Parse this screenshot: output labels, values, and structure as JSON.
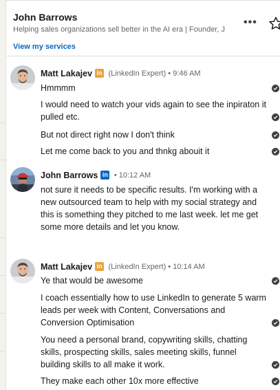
{
  "header": {
    "name": "John Barrows",
    "headline": "Helping sales organizations sell better in the AI era | Founder, J",
    "view_services": "View my services",
    "more_icon": "•••",
    "star_icon": "star-icon"
  },
  "groups": [
    {
      "sender": "Matt Lakajev",
      "badge": "in",
      "badge_color": "#e7a33e",
      "meta": "(LinkedIn Expert) • 9:46 AM",
      "messages": [
        "Hmmmm",
        "I would need to watch your vids again to see the inpiraton it pulled etc.",
        "But not direct right now I don't think",
        "Let me come back to you and thnkg abouit it"
      ]
    },
    {
      "sender": "John Barrows",
      "badge": "in",
      "badge_color": "#0a66c2",
      "meta": "• 10:12 AM",
      "messages": [
        "not sure it needs to be specific results.  I'm working with a new outsourced team to help with my social strategy and this is something they pitched to me last week.  let me get some more details and let you know."
      ]
    },
    {
      "sender": "Matt Lakajev",
      "badge": "in",
      "badge_color": "#e7a33e",
      "meta": "(LinkedIn Expert) • 10:14 AM",
      "messages": [
        "Ye that would be awesome",
        "I coach essentially how to use LinkedIn to generate 5 warm leads per week with Content, Conversations and Conversion Optimisation",
        "You need a personal brand, copywriting skills, chatting skills, prospecting skills, sales meeting skills, funnel building skills to all make it work.",
        "They make each other 10x more effective"
      ]
    }
  ],
  "colors": {
    "link": "#0a66c2",
    "text": "#191919",
    "muted": "#666666",
    "read_receipt": "#404040"
  }
}
